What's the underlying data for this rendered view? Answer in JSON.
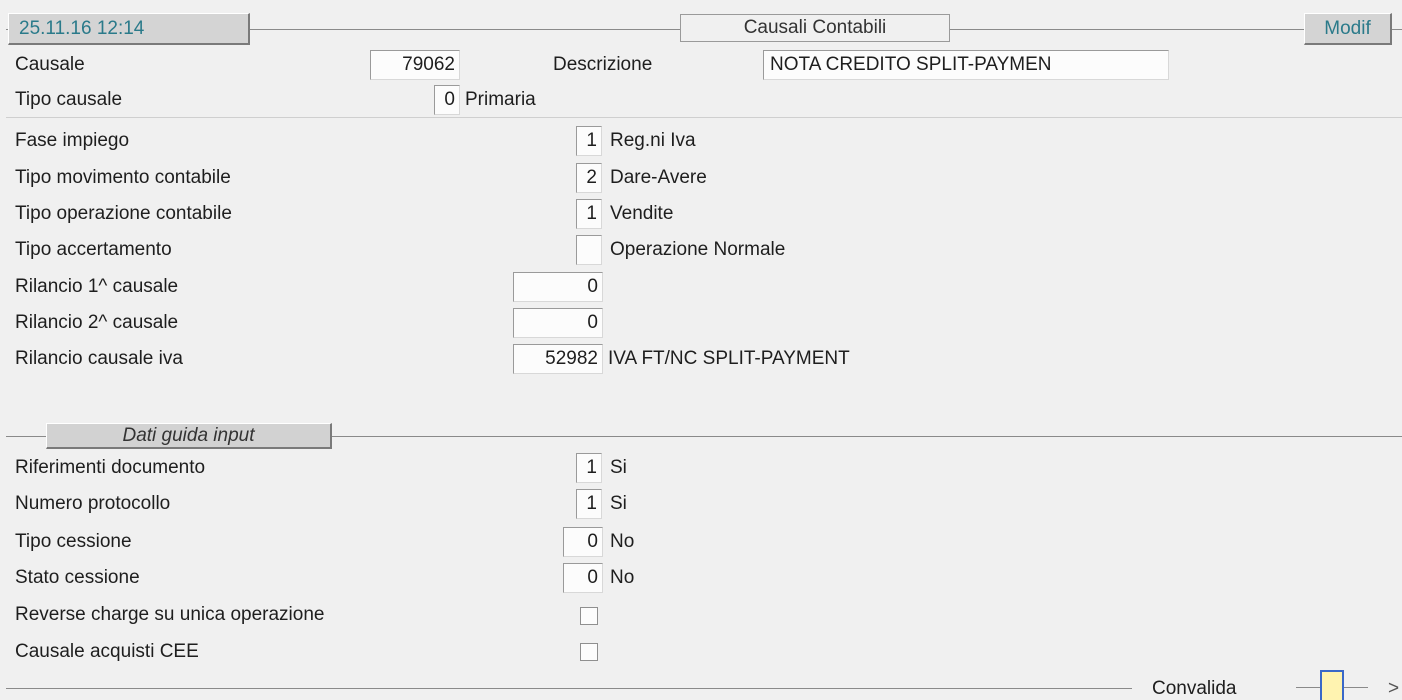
{
  "header": {
    "datetime": "25.11.16 12:14",
    "title": "Causali Contabili",
    "mode": "Modif"
  },
  "fields": {
    "causale": {
      "label": "Causale",
      "value": "79062"
    },
    "descrizione": {
      "label": "Descrizione",
      "value": "NOTA CREDITO SPLIT-PAYMEN"
    },
    "tipo_causale": {
      "label": "Tipo causale",
      "value": "0",
      "desc": "Primaria"
    },
    "fase_impiego": {
      "label": "Fase impiego",
      "value": "1",
      "desc": "Reg.ni Iva"
    },
    "tipo_movimento": {
      "label": "Tipo movimento contabile",
      "value": "2",
      "desc": "Dare-Avere"
    },
    "tipo_operazione": {
      "label": "Tipo operazione contabile",
      "value": "1",
      "desc": "Vendite"
    },
    "tipo_accertamento": {
      "label": "Tipo accertamento",
      "value": "",
      "desc": "Operazione Normale"
    },
    "rilancio_1": {
      "label": "Rilancio 1^ causale",
      "value": "0"
    },
    "rilancio_2": {
      "label": "Rilancio 2^ causale",
      "value": "0"
    },
    "rilancio_iva": {
      "label": "Rilancio causale iva",
      "value": "52982",
      "desc": "IVA FT/NC SPLIT-PAYMENT"
    }
  },
  "section": {
    "title": "Dati guida input"
  },
  "guide": {
    "riferimenti": {
      "label": "Riferimenti documento",
      "value": "1",
      "desc": "Si"
    },
    "protocollo": {
      "label": "Numero protocollo",
      "value": "1",
      "desc": "Si"
    },
    "tipo_cessione": {
      "label": "Tipo cessione",
      "value": "0",
      "desc": "No"
    },
    "stato_cessione": {
      "label": "Stato cessione",
      "value": "0",
      "desc": "No"
    },
    "reverse_charge": {
      "label": "Reverse charge su unica operazione",
      "checked": false
    },
    "acquisti_cee": {
      "label": "Causale acquisti CEE",
      "checked": false
    }
  },
  "footer": {
    "convalida_label": "Convalida",
    "next_glyph": ">"
  },
  "colors": {
    "header_text": "#2a7a8a",
    "button_highlight": "#fff3b0"
  }
}
